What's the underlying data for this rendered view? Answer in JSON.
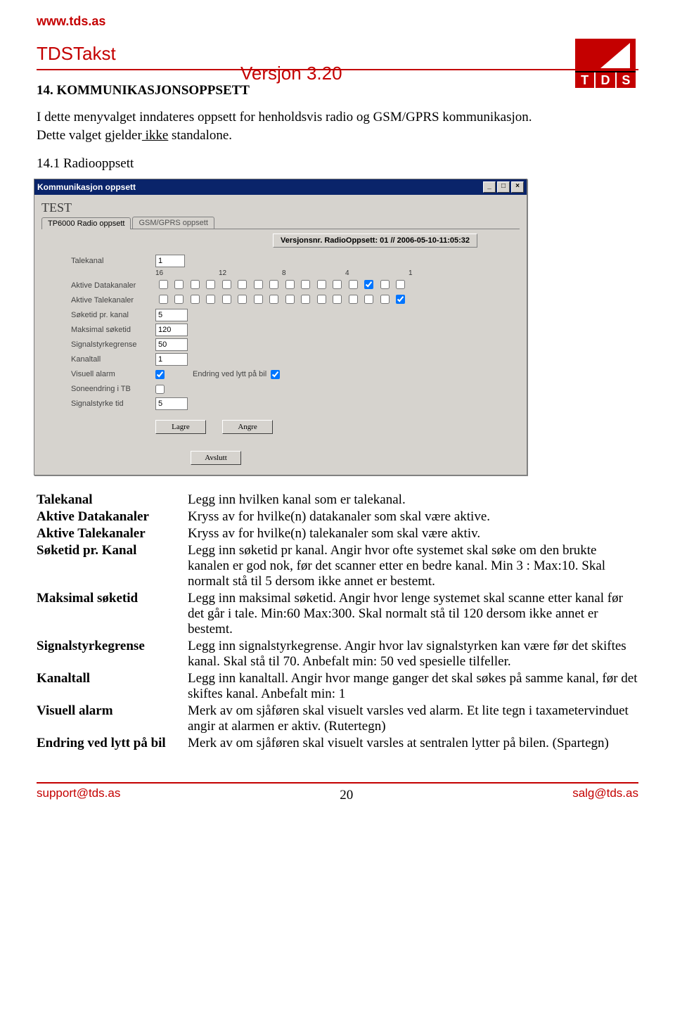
{
  "url": "www.tds.as",
  "app_title": "TDSTakst",
  "version": "Versjon 3.20",
  "logo_letters": [
    "T",
    "D",
    "S"
  ],
  "heading": "14.   KOMMUNIKASJONSOPPSETT",
  "intro_line1": "I dette menyvalget inndateres oppsett for henholdsvis radio og GSM/GPRS kommunikasjon.",
  "intro_line2_a": "Dette valget gjelder",
  "intro_line2_b": " ikke",
  "intro_line2_c": " standalone.",
  "subheading": "14.1  Radiooppsett",
  "win": {
    "title": "Kommunikasjon oppsett",
    "test": "TEST",
    "tab1": "TP6000 Radio oppsett",
    "tab2": "GSM/GPRS oppsett",
    "version_label": "Versjonsnr. RadioOppsett: 01 // 2006-05-10-11:05:32",
    "nums": [
      "16",
      "12",
      "8",
      "4",
      "1"
    ],
    "talekanal_label": "Talekanal",
    "talekanal_val": "1",
    "aktive_datakanaler_label": "Aktive Datakanaler",
    "aktive_talekanaler_label": "Aktive Talekanaler",
    "soketid_label": "Søketid pr. kanal",
    "soketid_val": "5",
    "maksimal_label": "Maksimal søketid",
    "maksimal_val": "120",
    "signal_label": "Signalstyrkegrense",
    "signal_val": "50",
    "kanaltall_label": "Kanaltall",
    "kanaltall_val": "1",
    "visuell_label": "Visuell alarm",
    "endring_label": "Endring ved lytt på bil",
    "soneendring_label": "Soneendring i TB",
    "signalstyrke_tid_label": "Signalstyrke tid",
    "signalstyrke_tid_val": "5",
    "lagre": "Lagre",
    "angre": "Angre",
    "avslutt": "Avslutt"
  },
  "defs": [
    {
      "term": "Talekanal",
      "desc": "Legg inn hvilken kanal som er talekanal."
    },
    {
      "term": "Aktive Datakanaler",
      "desc": "Kryss av for hvilke(n) datakanaler som skal være aktive."
    },
    {
      "term": "Aktive Talekanaler",
      "desc": "Kryss av for hvilke(n) talekanaler som skal være aktiv."
    },
    {
      "term": "Søketid pr. Kanal",
      "desc": "Legg inn søketid pr kanal. Angir hvor ofte systemet skal søke om den brukte kanalen er god nok, før det scanner etter en bedre kanal. Min 3 : Max:10.  Skal normalt stå til 5 dersom ikke annet er bestemt."
    },
    {
      "term": "Maksimal søketid",
      "desc": "Legg inn maksimal søketid. Angir hvor lenge systemet skal scanne etter kanal før det går i tale. Min:60  Max:300. Skal normalt stå til 120 dersom ikke annet er bestemt."
    },
    {
      "term": "Signalstyrkegrense",
      "desc": "Legg inn signalstyrkegrense. Angir hvor lav signalstyrken kan være før det skiftes kanal. Skal stå til 70.  Anbefalt min: 50 ved spesielle tilfeller."
    },
    {
      "term": "Kanaltall",
      "desc": "Legg inn kanaltall. Angir hvor mange ganger det skal søkes på samme kanal, før det skiftes kanal. Anbefalt min: 1"
    },
    {
      "term": "Visuell alarm",
      "desc": "Merk av om sjåføren skal visuelt varsles ved alarm. Et lite tegn i taxametervinduet angir at alarmen er aktiv. (Rutertegn)"
    },
    {
      "term": "Endring ved lytt på bil",
      "desc": "Merk av om sjåføren skal visuelt varsles at sentralen lytter på bilen. (Spartegn)"
    }
  ],
  "footer": {
    "left": "support@tds.as",
    "page": "20",
    "right": "salg@tds.as"
  }
}
